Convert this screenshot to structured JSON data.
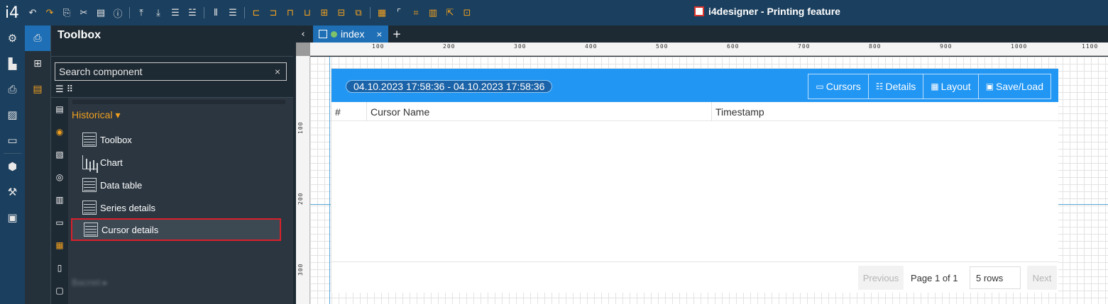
{
  "app": {
    "logo": "i4",
    "title": "i4designer - Printing feature"
  },
  "toolbar": {
    "icons": [
      "undo-icon",
      "redo-icon",
      "copy-icon",
      "cut-icon",
      "paste-icon",
      "info-icon",
      "align-top-icon",
      "align-bottom-icon",
      "distribute-top-icon",
      "distribute-bottom-icon",
      "distribute-columns-icon",
      "distribute-rows-icon",
      "align-left-icon",
      "align-right-icon",
      "align-top-edges-icon",
      "align-bottom-edges-icon",
      "center-vertical-icon",
      "center-horizontal-icon",
      "bring-front-icon",
      "grid-icon",
      "snap-corner-icon",
      "snap-center-icon",
      "table-grid-icon",
      "pointer-grid-icon",
      "fit-icon"
    ]
  },
  "rail": {
    "icons": [
      "gear-icon",
      "dashboard-icon",
      "printer-icon",
      "report-icon",
      "monitor-icon",
      "package-icon",
      "settings-map-icon",
      "archive-icon"
    ]
  },
  "panel": {
    "title": "Toolbox",
    "search_placeholder": "Search component",
    "search_value": "",
    "clear_symbol": "×",
    "category": "Historical ▾",
    "components": [
      {
        "label": "Toolbox",
        "icon": "table"
      },
      {
        "label": "Chart",
        "icon": "chart"
      },
      {
        "label": "Data table",
        "icon": "table"
      },
      {
        "label": "Series details",
        "icon": "table"
      },
      {
        "label": "Cursor details",
        "icon": "table"
      }
    ],
    "blurred_label": "Bacnet ▸"
  },
  "tabs": {
    "back": "‹",
    "active_tab": "index",
    "close": "×",
    "add": "+"
  },
  "ruler": {
    "h_labels": [
      "100",
      "200",
      "300",
      "400",
      "500",
      "600",
      "700",
      "800",
      "900",
      "1000",
      "1100"
    ],
    "v_labels": [
      "100",
      "200",
      "300"
    ]
  },
  "widget": {
    "date_range": "04.10.2023 17:58:36 - 04.10.2023 17:58:36",
    "buttons": [
      {
        "label": "Cursors",
        "icon": "▭"
      },
      {
        "label": "Details",
        "icon": "☷"
      },
      {
        "label": "Layout",
        "icon": "▦"
      },
      {
        "label": "Save/Load",
        "icon": "▣"
      }
    ],
    "columns": [
      "#",
      "Cursor Name",
      "Timestamp"
    ],
    "pagination": {
      "prev": "Previous",
      "page_info": "Page 1 of 1",
      "rows": "5 rows",
      "next": "Next"
    }
  }
}
